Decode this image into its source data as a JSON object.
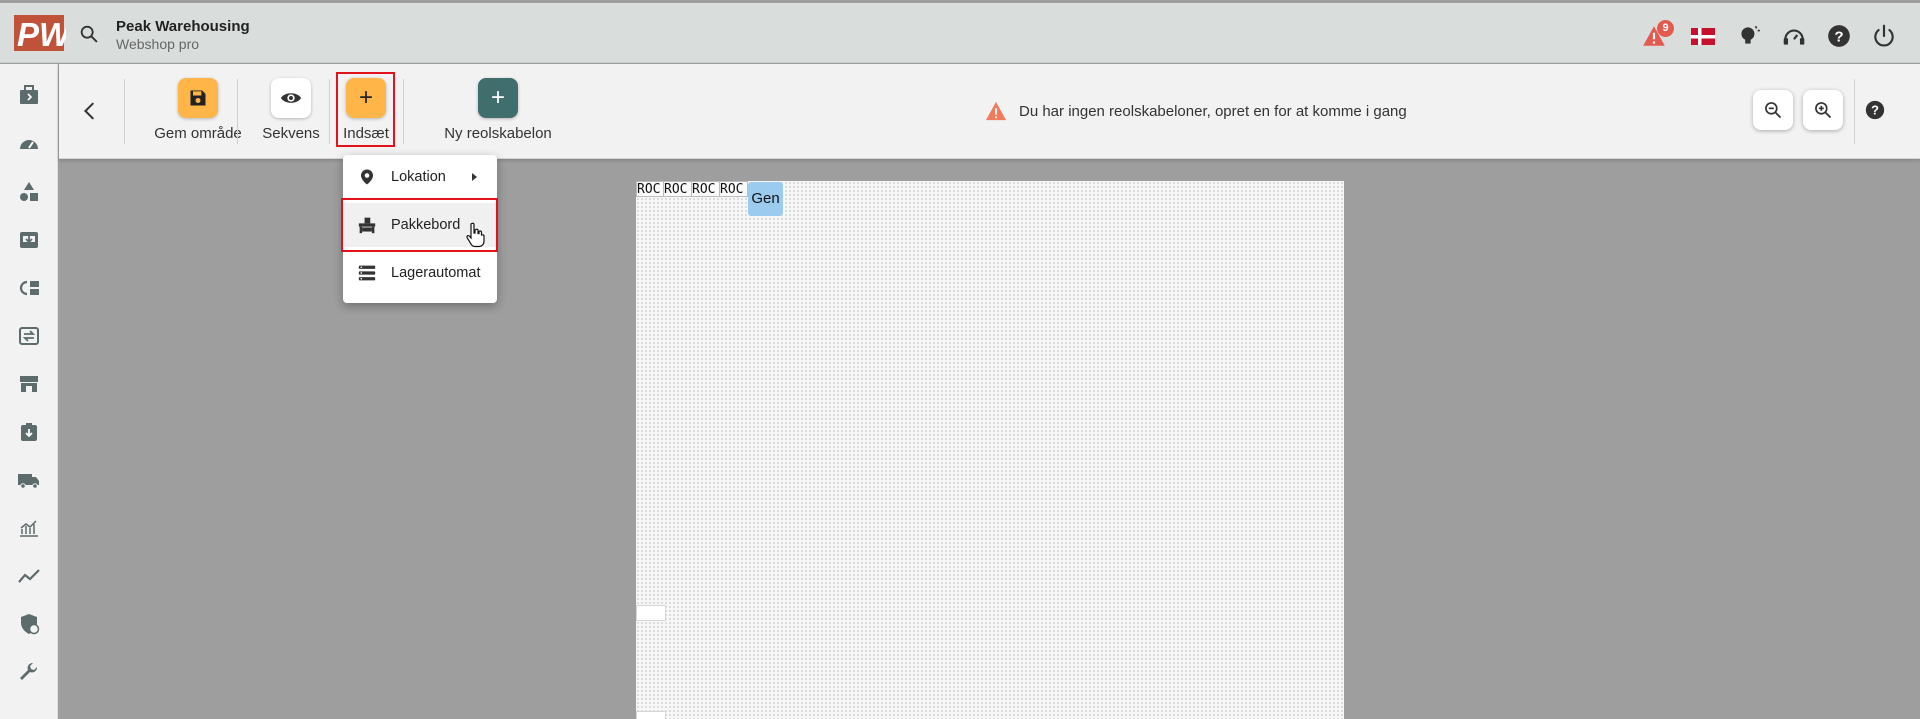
{
  "header": {
    "brand_name": "Peak Warehousing",
    "brand_sub": "Webshop pro",
    "notification_count": "9",
    "icons": [
      "search-icon",
      "alert-icon",
      "danish-flag-icon",
      "lightbulb-icon",
      "headset-icon",
      "help-icon",
      "power-icon"
    ]
  },
  "sidebar": {
    "items": [
      "box-icon",
      "dashboard-icon",
      "shapes-icon",
      "inbox-icon",
      "returns-icon",
      "transfer-icon",
      "store-icon",
      "package-icon",
      "truck-icon",
      "chart-icon",
      "trend-icon",
      "shield-icon",
      "wrench-icon"
    ]
  },
  "toolbar": {
    "save_label": "Gem område",
    "sequence_label": "Sekvens",
    "insert_label": "Indsæt",
    "insert_symbol": "+",
    "new_template_label": "Ny reolskabelon",
    "new_template_symbol": "+",
    "warning_text": "Du har ingen reolskabeloner, opret en for at komme i gang"
  },
  "insert_menu": {
    "items": [
      {
        "label": "Lokation",
        "icon": "location-pin-icon",
        "has_submenu": true
      },
      {
        "label": "Pakkebord",
        "icon": "packing-table-icon",
        "highlighted": true
      },
      {
        "label": "Lagerautomat",
        "icon": "storage-automat-icon"
      }
    ]
  },
  "canvas": {
    "racks": [
      "ROC",
      "ROC",
      "ROC",
      "ROC"
    ],
    "gen_label": "Gen"
  },
  "colors": {
    "accent_orange": "#ffb547",
    "teal": "#3f6e6c",
    "highlight_red": "#e0121b",
    "warning": "#f07a5c",
    "logo": "#c0523a"
  }
}
